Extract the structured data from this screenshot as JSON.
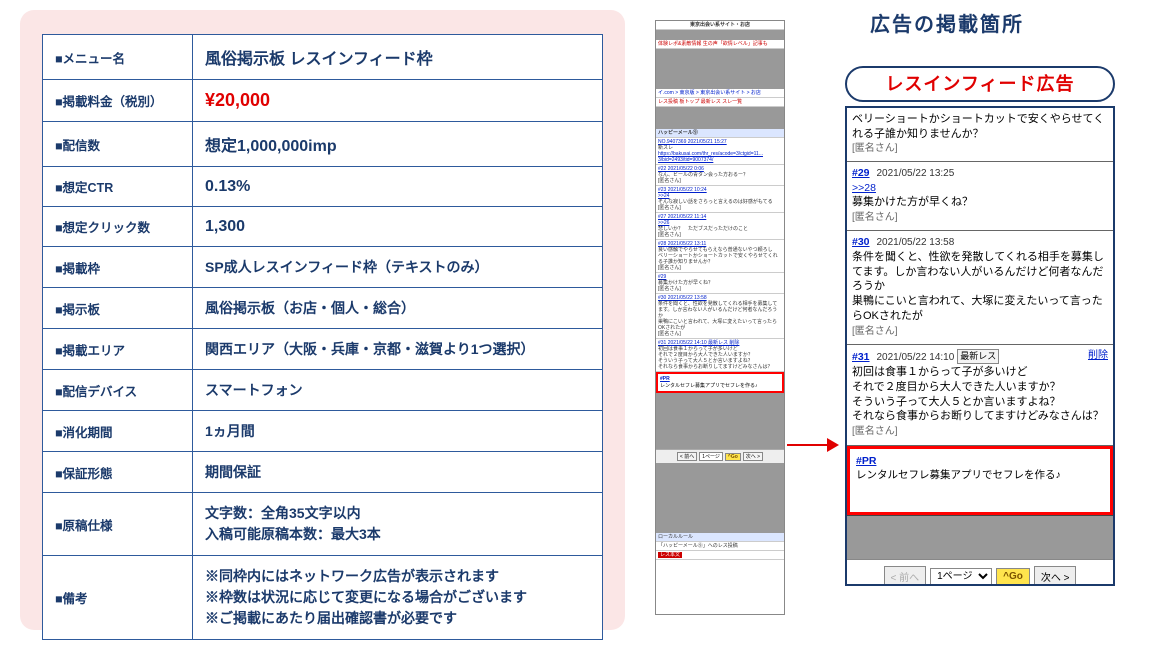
{
  "spec": {
    "rows": [
      {
        "label": "■メニュー名",
        "value": "風俗掲示板 レスインフィード枠",
        "cls": "big"
      },
      {
        "label": "■掲載料金（税別）",
        "value": "¥20,000",
        "cls": "price"
      },
      {
        "label": "■配信数",
        "value": "想定1,000,000imp",
        "cls": "big"
      },
      {
        "label": "■想定CTR",
        "value": "0.13%",
        "cls": "big"
      },
      {
        "label": "■想定クリック数",
        "value": "1,300",
        "cls": "big"
      },
      {
        "label": "■掲載枠",
        "value": "SP成人レスインフィード枠（テキストのみ）",
        "cls": ""
      },
      {
        "label": "■掲示板",
        "value": "風俗掲示板（お店・個人・総合）",
        "cls": ""
      },
      {
        "label": "■掲載エリア",
        "value": "関西エリア（大阪・兵庫・京都・滋賀より1つ選択）",
        "cls": ""
      },
      {
        "label": "■配信デバイス",
        "value": "スマートフォン",
        "cls": ""
      },
      {
        "label": "■消化期間",
        "value": "1ヵ月間",
        "cls": ""
      },
      {
        "label": "■保証形態",
        "value": "期間保証",
        "cls": ""
      },
      {
        "label": "■原稿仕様",
        "value": "文字数：全角35文字以内\n入稿可能原稿本数：最大3本",
        "cls": ""
      },
      {
        "label": "■備考",
        "value": "※同枠内にはネットワーク広告が表示されます\n※枠数は状況に応じて変更になる場合がございます\n※ご掲載にあたり届出確認書が必要です",
        "cls": ""
      }
    ]
  },
  "placement_title": "広告の掲載箇所",
  "pill_label": "レスインフィード広告",
  "mini": {
    "top_title": "東京出会い系サイト・お店",
    "red_strip": "体験レポ&素敵情報 生の声「欲情レベル」記事も",
    "breadcrumb": "イ.com > 東京版 > 東京出会い系サイト > お店",
    "tabs": "レス投稿  板トップ  最新レス  スレ一覧",
    "thread_title": "ハッピーメール⑨",
    "thread_meta": "NO.9407369  2021/05/21 15:27",
    "post_body1": "新スレ",
    "post_link": "https://bakusai.com/thr_res/acode=3/ctgid=11...",
    "post_link2": "3/bid=2493/tid=9007374/",
    "r22_ts": "#22  2021/05/22 0:06",
    "r22_body": "なん、ビールの青タン会った方おるー？",
    "r22_anon": "[匿名さん]",
    "r23_ts": "#23  2021/05/22 10:24",
    "r24_num": ">>24",
    "r24_body": "そんな寂しい話をさらっと言えるのは好感がもてる",
    "r24_anon": "[匿名さん]",
    "r27_ts": "#27  2021/05/22 11:14",
    "r27_num": ">>26",
    "r27_body": "悲しいか？　ただブスだっただけのこと",
    "r27_anon": "[匿名さん]",
    "r28_ts": "#28  2021/05/22 13:11",
    "r28_body1": "良い感触でやらせてもらえなら普通ないやつ頼ろし",
    "r28_body2": "ベリーショートかショートカットで安くやらせてくれる子誰か知りませんか？",
    "r28_anon": "[匿名さん]",
    "r29_num": "#29",
    "r29_body": "募集かけた方が早くね？",
    "r29_anon": "[匿名さん]",
    "r30_ts": "#30  2021/05/22 13:58",
    "r30_body1": "条件を聞くと、性欲を発散してくれる相手を募集してます。しか言わない人がいるんだけど何者なんだろうか",
    "r30_body2": "巣鴨にこいと言われて、大塚に変えたいって言ったらOKされたが",
    "r30_anon": "[匿名さん]",
    "r31_ts": "#31  2021/05/22 14:10  最新レス          削除",
    "r31_body": "初回は食事１からって子が多いけど\nそれで２度目から大人できた人いますか？\nそういう子って大人５とか言いますよね？\nそれなら食事からお断りしてますけどみなさんは？",
    "pr_label": "#PR",
    "pr_text": "レンタルセフレ募集アプリでセフレを作る♪",
    "nav_prev": "< 前へ",
    "nav_sel": "1ページ",
    "nav_go": "^Go",
    "nav_next": "次へ >",
    "local_rule": "ローカルルール",
    "footer": "「ハッピーメール⑨」へのレス投稿",
    "res_btn": "レス本文"
  },
  "big": {
    "top_body": "ベリーショートかショートカットで安くやらせてくれる子誰か知りませんか？",
    "top_anon": "[匿名さん]",
    "p29_num": "#29",
    "p29_ts": "2021/05/22 13:25",
    "p29_reply": ">>28",
    "p29_body": "募集かけた方が早くね？",
    "p29_anon": "[匿名さん]",
    "p30_num": "#30",
    "p30_ts": "2021/05/22 13:58",
    "p30_body": "条件を聞くと、性欲を発散してくれる相手を募集してます。しか言わない人がいるんだけど何者なんだろうか\n巣鴨にこいと言われて、大塚に変えたいって言ったらOKされたが",
    "p30_anon": "[匿名さん]",
    "p31_num": "#31",
    "p31_ts": "2021/05/22 14:10",
    "p31_badge": "最新レス",
    "p31_del": "削除",
    "p31_body": "初回は食事１からって子が多いけど\nそれで２度目から大人できた人いますか？\nそういう子って大人５とか言いますよね？\nそれなら食事からお断りしてますけどみなさんは？",
    "p31_anon": "[匿名さん]",
    "pr_label": "#PR",
    "pr_text": "レンタルセフレ募集アプリでセフレを作る♪",
    "nav_prev": "< 前へ",
    "nav_sel": "1ページ",
    "nav_go": "^Go",
    "nav_next": "次へ >"
  }
}
